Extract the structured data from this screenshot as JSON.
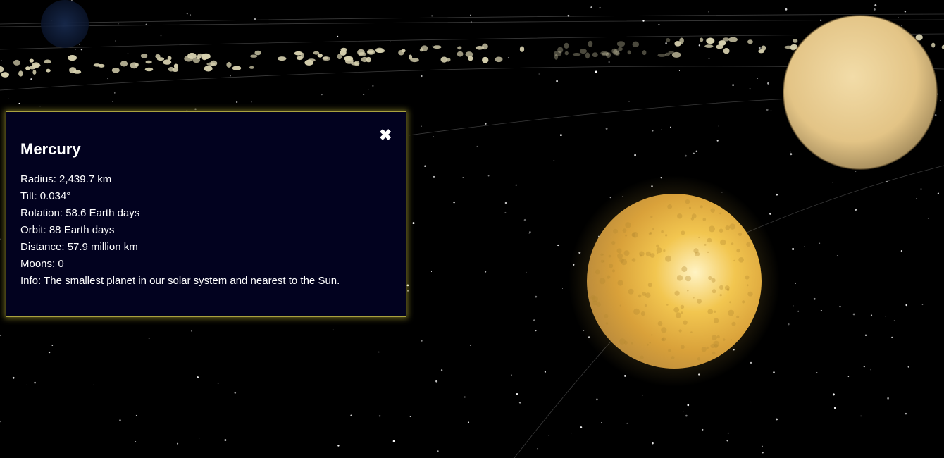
{
  "scene": {
    "background_color": "#000000",
    "selected_planet_color": "#f3c64b",
    "background_planet_color": "#e9cf94",
    "asteroid_color": "#d8d2b0",
    "panel_border_color": "#a9a23f"
  },
  "info_panel": {
    "title": "Mercury",
    "close_icon": "close-icon",
    "close_glyph": "✖",
    "lines": [
      "Radius: 2,439.7 km",
      "Tilt: 0.034°",
      "Rotation: 58.6 Earth days",
      "Orbit: 88 Earth days",
      "Distance: 57.9 million km",
      "Moons: 0",
      "Info: The smallest planet in our solar system and nearest to the Sun."
    ]
  }
}
